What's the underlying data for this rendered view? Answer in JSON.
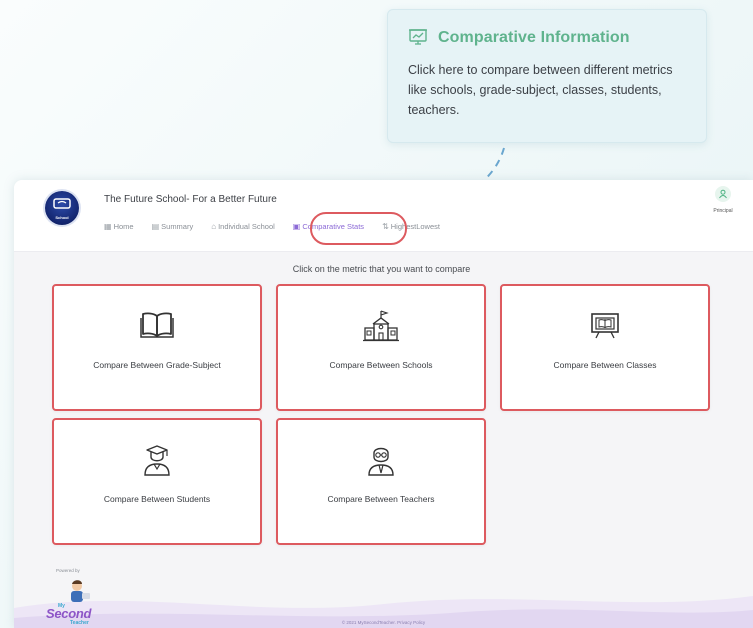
{
  "tooltip": {
    "title": "Comparative Information",
    "body": "Click here to compare between different metrics like schools, grade-subject, classes, students, teachers.",
    "icon": "presentation-chart-icon",
    "accent": "#5fb38d"
  },
  "header": {
    "school_name": "The Future School- For a Better Future",
    "logo_text": "School",
    "profile_role": "Principal"
  },
  "nav": {
    "items": [
      {
        "label": "Home",
        "icon": "grid-icon"
      },
      {
        "label": "Summary",
        "icon": "summary-icon"
      },
      {
        "label": "Individual School",
        "icon": "school-icon"
      },
      {
        "label": "Comparative Stats",
        "icon": "presentation-icon",
        "active": true
      },
      {
        "label": "HighestLowest",
        "icon": "sort-icon"
      }
    ]
  },
  "main": {
    "instruction": "Click on the metric that you want to compare",
    "cards": [
      {
        "label": "Compare Between Grade-Subject",
        "icon": "open-book-icon"
      },
      {
        "label": "Compare Between Schools",
        "icon": "school-building-icon"
      },
      {
        "label": "Compare Between Classes",
        "icon": "classroom-board-icon"
      },
      {
        "label": "Compare Between Students",
        "icon": "graduate-student-icon"
      },
      {
        "label": "Compare Between Teachers",
        "icon": "teacher-icon"
      }
    ]
  },
  "branding": {
    "powered_by": "Powered by",
    "brand_my": "My",
    "brand_second": "Second",
    "brand_teacher": "Teacher"
  },
  "footer": {
    "text": "© 2021 MySecondTeacher. Privacy Policy"
  },
  "colors": {
    "highlight": "#dd5a5f",
    "active_nav": "#8c6ad6",
    "arrow": "#6aa6cf"
  }
}
